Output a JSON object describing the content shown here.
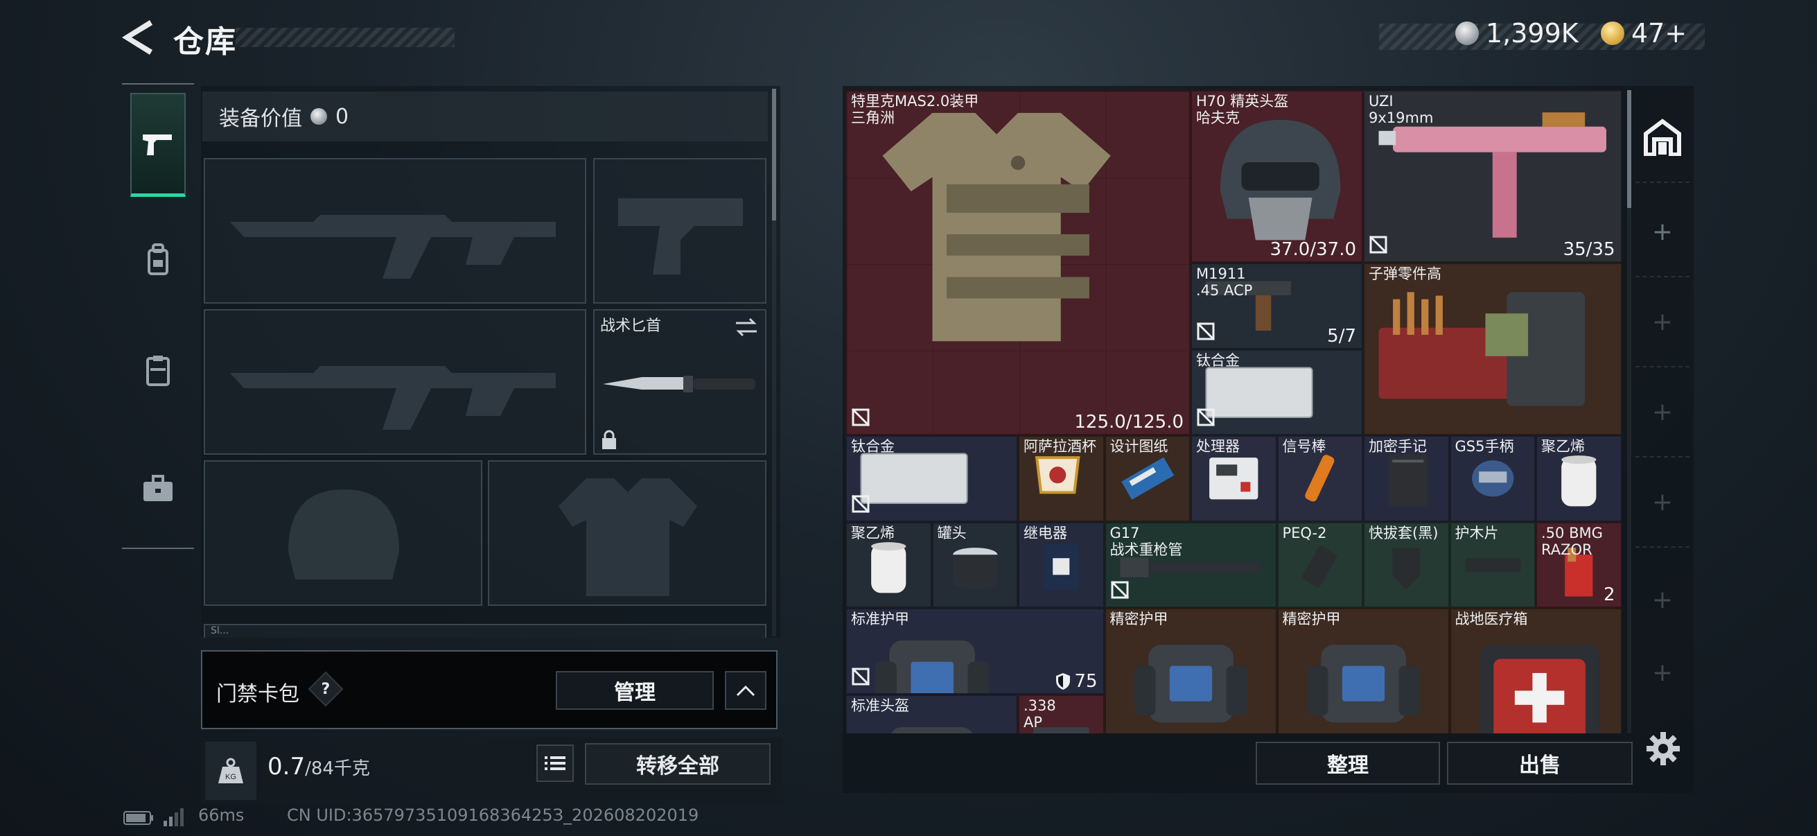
{
  "header": {
    "title": "仓库",
    "currency_silver": "1,399K",
    "currency_gold": "47+"
  },
  "loadout": {
    "equip_value_label": "装备价值",
    "equip_value": "0",
    "melee_label": "战术匕首",
    "partial_label": "Sl...",
    "keycard_label": "门禁卡包",
    "keycard_help": "?",
    "manage_label": "管理",
    "weight_value": "0.7",
    "weight_capacity": "/84千克",
    "kg_label": "KG",
    "transfer_label": "转移全部"
  },
  "stash": {
    "items": [
      {
        "name": "特里克MAS2.0装甲\n三角洲",
        "value": "125.0/125.0"
      },
      {
        "name": "H70 精英头盔\n哈夫克",
        "value": "37.0/37.0"
      },
      {
        "name": "UZI\n9x19mm",
        "value": "35/35"
      },
      {
        "name": "M1911\n.45 ACP",
        "value": "5/7"
      },
      {
        "name": "子弹零件高",
        "value": ""
      },
      {
        "name": "钛合金",
        "value": ""
      },
      {
        "name": "钛合金",
        "value": ""
      },
      {
        "name": "阿萨拉酒杯",
        "value": ""
      },
      {
        "name": "设计图纸",
        "value": ""
      },
      {
        "name": "处理器",
        "value": ""
      },
      {
        "name": "信号棒",
        "value": ""
      },
      {
        "name": "加密手记",
        "value": ""
      },
      {
        "name": "GS5手柄",
        "value": ""
      },
      {
        "name": "聚乙烯",
        "value": ""
      },
      {
        "name": "聚乙烯",
        "value": ""
      },
      {
        "name": "罐头",
        "value": ""
      },
      {
        "name": "继电器",
        "value": ""
      },
      {
        "name": "G17\n战术重枪管",
        "value": ""
      },
      {
        "name": "PEQ-2",
        "value": ""
      },
      {
        "name": "快拔套(黑)",
        "value": ""
      },
      {
        "name": "护木片",
        "value": ""
      },
      {
        "name": ".50 BMG\nRAZOR",
        "value": "2"
      },
      {
        "name": "标准护甲",
        "value": "75"
      },
      {
        "name": "精密护甲",
        "value": ""
      },
      {
        "name": "精密护甲",
        "value": ""
      },
      {
        "name": "战地医疗箱",
        "value": ""
      },
      {
        "name": "标准头盔",
        "value": ""
      },
      {
        "name": ".338\nAP",
        "value": ""
      }
    ],
    "sort_label": "整理",
    "sell_label": "出售"
  },
  "status": {
    "ping": "66ms",
    "uid": "CN UID:3657973510916836425З_202608202019"
  }
}
